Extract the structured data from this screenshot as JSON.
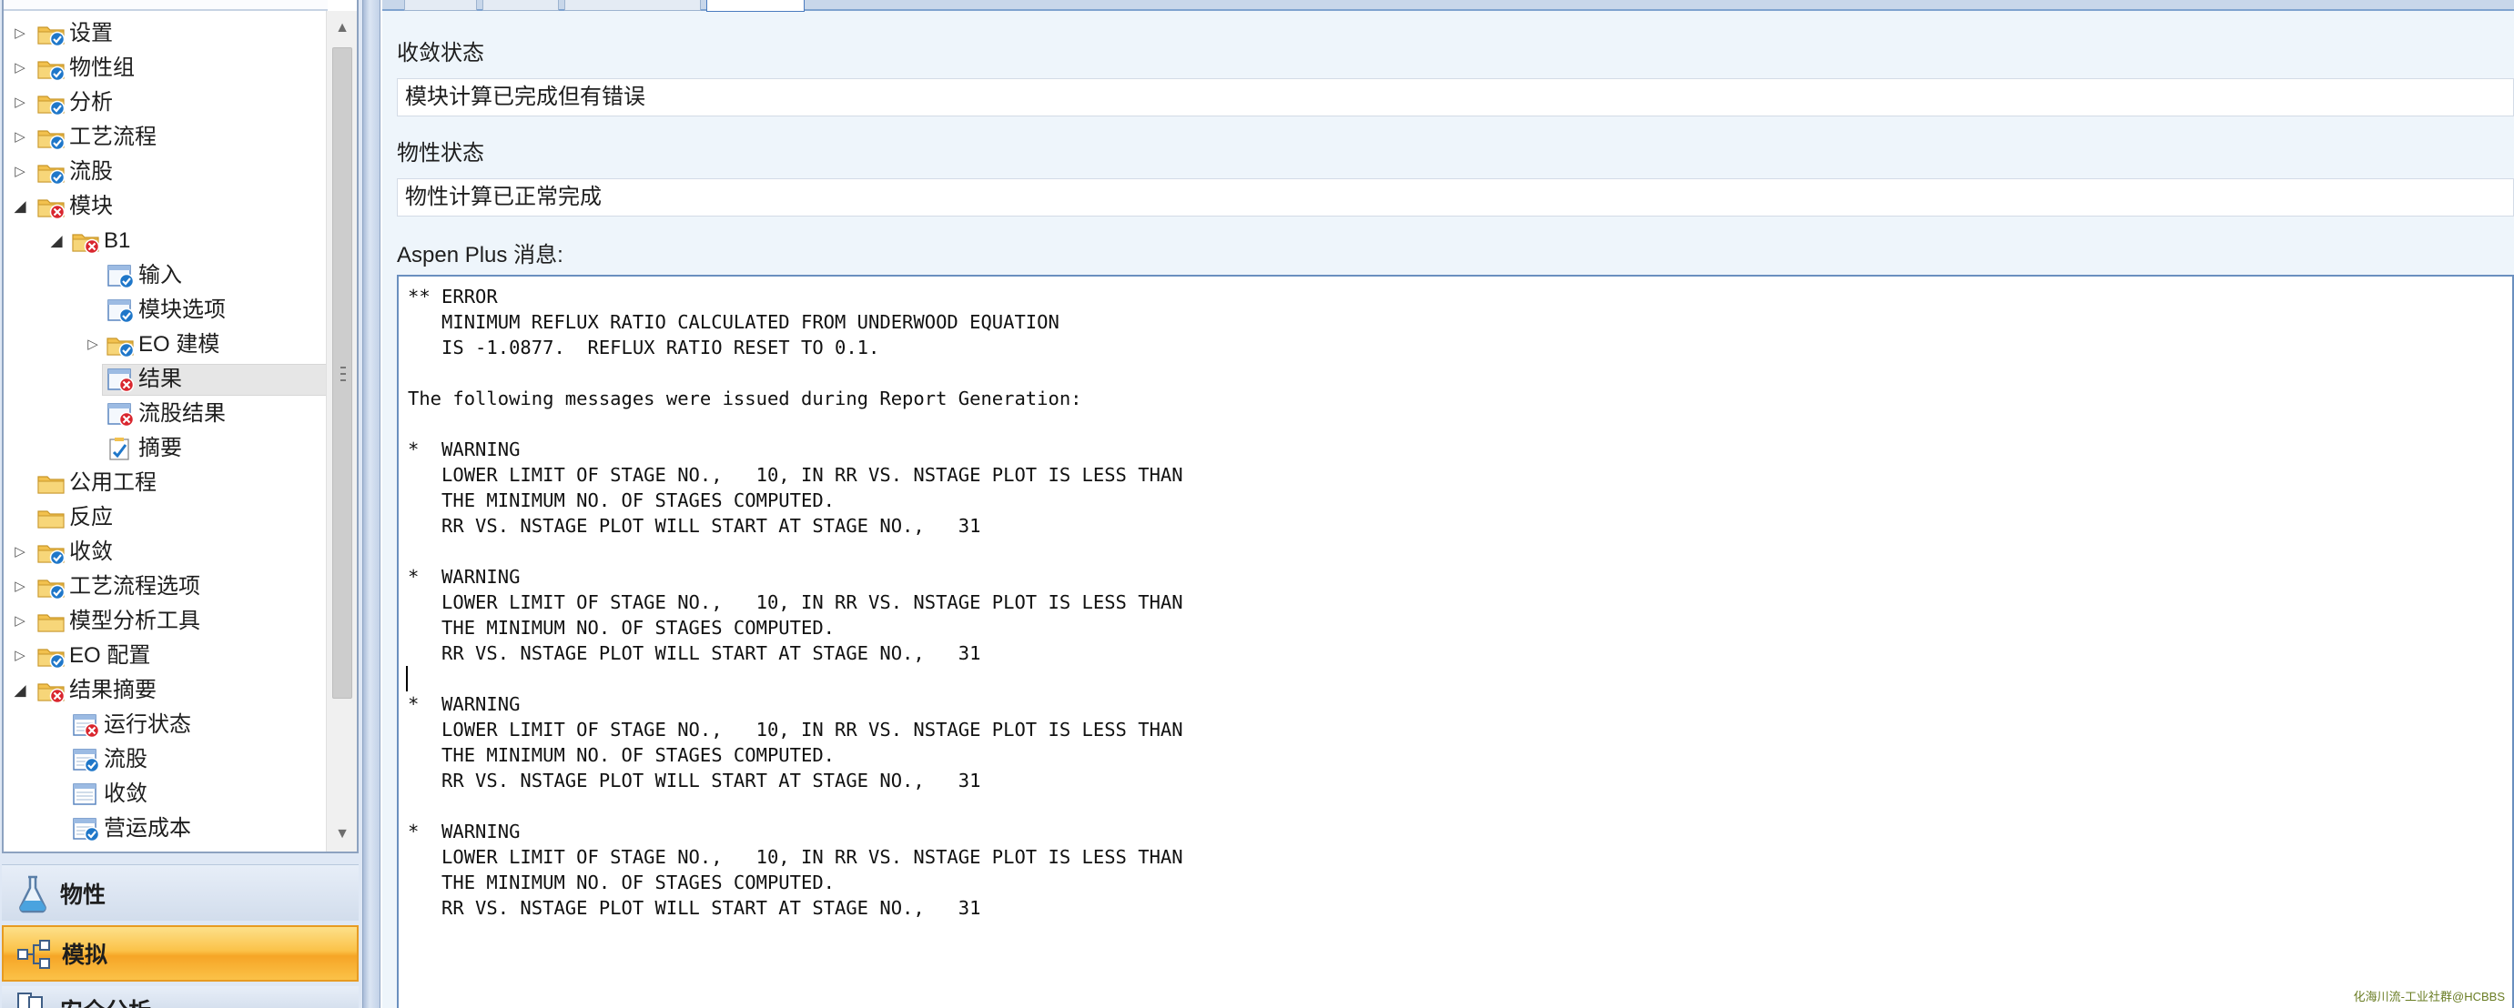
{
  "colors": {
    "folder": "#f2c14e",
    "check_ok": "#1f77c9",
    "error": "#d9262e",
    "selected_row": "#e6e6e6",
    "simulation_button": "#fbc248",
    "editor_border": "#6a8fbf"
  },
  "tree": {
    "items": [
      {
        "label": "设置",
        "level": 0,
        "expander": "collapsed",
        "icon": "folder-check-icon"
      },
      {
        "label": "物性组",
        "level": 0,
        "expander": "collapsed",
        "icon": "folder-check-icon"
      },
      {
        "label": "分析",
        "level": 0,
        "expander": "collapsed",
        "icon": "folder-check-icon"
      },
      {
        "label": "工艺流程",
        "level": 0,
        "expander": "collapsed",
        "icon": "folder-check-icon"
      },
      {
        "label": "流股",
        "level": 0,
        "expander": "collapsed",
        "icon": "folder-check-icon"
      },
      {
        "label": "模块",
        "level": 0,
        "expander": "expanded",
        "icon": "folder-error-icon"
      },
      {
        "label": "B1",
        "level": 1,
        "expander": "expanded",
        "icon": "folder-error-icon"
      },
      {
        "label": "输入",
        "level": 2,
        "expander": "none",
        "icon": "form-check-icon"
      },
      {
        "label": "模块选项",
        "level": 2,
        "expander": "none",
        "icon": "form-check-icon"
      },
      {
        "label": "EO 建模",
        "level": 2,
        "expander": "collapsed",
        "icon": "folder-check-icon"
      },
      {
        "label": "结果",
        "level": 2,
        "expander": "none",
        "icon": "form-error-icon",
        "selected": true
      },
      {
        "label": "流股结果",
        "level": 2,
        "expander": "none",
        "icon": "form-error-icon"
      },
      {
        "label": "摘要",
        "level": 2,
        "expander": "none",
        "icon": "summary-check-icon"
      },
      {
        "label": "公用工程",
        "level": 0,
        "expander": "none",
        "icon": "folder-icon"
      },
      {
        "label": "反应",
        "level": 0,
        "expander": "none",
        "icon": "folder-icon"
      },
      {
        "label": "收敛",
        "level": 0,
        "expander": "collapsed",
        "icon": "folder-check-icon"
      },
      {
        "label": "工艺流程选项",
        "level": 0,
        "expander": "collapsed",
        "icon": "folder-check-icon"
      },
      {
        "label": "模型分析工具",
        "level": 0,
        "expander": "collapsed",
        "icon": "folder-icon"
      },
      {
        "label": "EO 配置",
        "level": 0,
        "expander": "collapsed",
        "icon": "folder-check-icon"
      },
      {
        "label": "结果摘要",
        "level": 0,
        "expander": "expanded",
        "icon": "folder-error-icon"
      },
      {
        "label": "运行状态",
        "level": 1,
        "expander": "none",
        "icon": "table-error-icon"
      },
      {
        "label": "流股",
        "level": 1,
        "expander": "none",
        "icon": "table-check-icon"
      },
      {
        "label": "收敛",
        "level": 1,
        "expander": "none",
        "icon": "table-icon"
      },
      {
        "label": "营运成本",
        "level": 1,
        "expander": "none",
        "icon": "table-check-icon"
      }
    ]
  },
  "nav_buttons": {
    "properties": "物性",
    "simulation": "模拟",
    "safety": "安全分析"
  },
  "status": {
    "convergence_label": "收敛状态",
    "convergence_value": "模块计算已完成但有错误",
    "property_label": "物性状态",
    "property_value": "物性计算已正常完成",
    "messages_label": "Aspen Plus 消息:"
  },
  "messages": [
    "** ERROR",
    "   MINIMUM REFLUX RATIO CALCULATED FROM UNDERWOOD EQUATION",
    "   IS -1.0877.  REFLUX RATIO RESET TO 0.1.",
    "",
    "The following messages were issued during Report Generation:",
    "",
    "*  WARNING",
    "   LOWER LIMIT OF STAGE NO.,   10, IN RR VS. NSTAGE PLOT IS LESS THAN",
    "   THE MINIMUM NO. OF STAGES COMPUTED.",
    "   RR VS. NSTAGE PLOT WILL START AT STAGE NO.,   31",
    "",
    "*  WARNING",
    "   LOWER LIMIT OF STAGE NO.,   10, IN RR VS. NSTAGE PLOT IS LESS THAN",
    "   THE MINIMUM NO. OF STAGES COMPUTED.",
    "   RR VS. NSTAGE PLOT WILL START AT STAGE NO.,   31",
    "",
    "*  WARNING",
    "   LOWER LIMIT OF STAGE NO.,   10, IN RR VS. NSTAGE PLOT IS LESS THAN",
    "   THE MINIMUM NO. OF STAGES COMPUTED.",
    "   RR VS. NSTAGE PLOT WILL START AT STAGE NO.,   31",
    "",
    "*  WARNING",
    "   LOWER LIMIT OF STAGE NO.,   10, IN RR VS. NSTAGE PLOT IS LESS THAN",
    "   THE MINIMUM NO. OF STAGES COMPUTED.",
    "   RR VS. NSTAGE PLOT WILL START AT STAGE NO.,   31"
  ],
  "watermark": "化海川流-工业社群@HCBBS"
}
